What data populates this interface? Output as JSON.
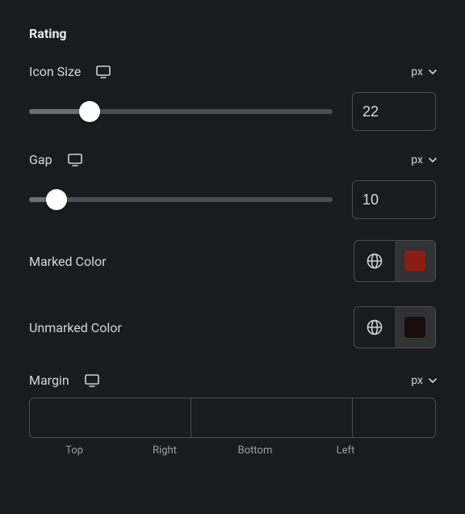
{
  "section": {
    "title": "Rating"
  },
  "iconSize": {
    "label": "Icon Size",
    "unit": "px",
    "value": "22",
    "percent": 20
  },
  "gap": {
    "label": "Gap",
    "unit": "px",
    "value": "10",
    "percent": 9
  },
  "markedColor": {
    "label": "Marked Color",
    "swatch": "#8b1d12"
  },
  "unmarkedColor": {
    "label": "Unmarked Color",
    "swatch": "#1a0d0a"
  },
  "margin": {
    "label": "Margin",
    "unit": "px",
    "top": "",
    "right": "",
    "bottom": "",
    "left": "",
    "labels": {
      "top": "Top",
      "right": "Right",
      "bottom": "Bottom",
      "left": "Left"
    }
  }
}
